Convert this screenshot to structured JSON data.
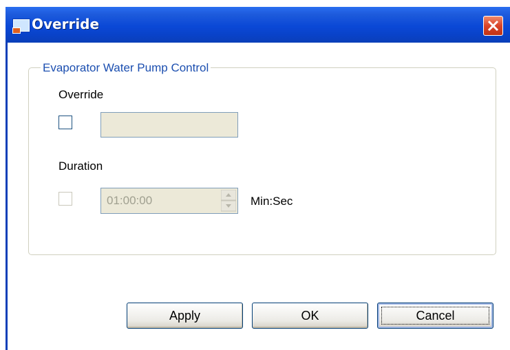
{
  "window": {
    "title": "Override"
  },
  "group": {
    "legend": "Evaporator Water Pump Control"
  },
  "override": {
    "label": "Override",
    "checked": false,
    "value": ""
  },
  "duration": {
    "label": "Duration",
    "checked": false,
    "value": "01:00:00",
    "unit": "Min:Sec"
  },
  "buttons": {
    "apply": "Apply",
    "ok": "OK",
    "cancel": "Cancel"
  },
  "icons": {
    "title": "app-window-icon",
    "close": "close-icon",
    "spin_up": "arrow-up-icon",
    "spin_down": "arrow-down-icon"
  },
  "colors": {
    "titlebar": "#0a48d6",
    "close": "#d9442a",
    "legend": "#1c4fb0"
  }
}
